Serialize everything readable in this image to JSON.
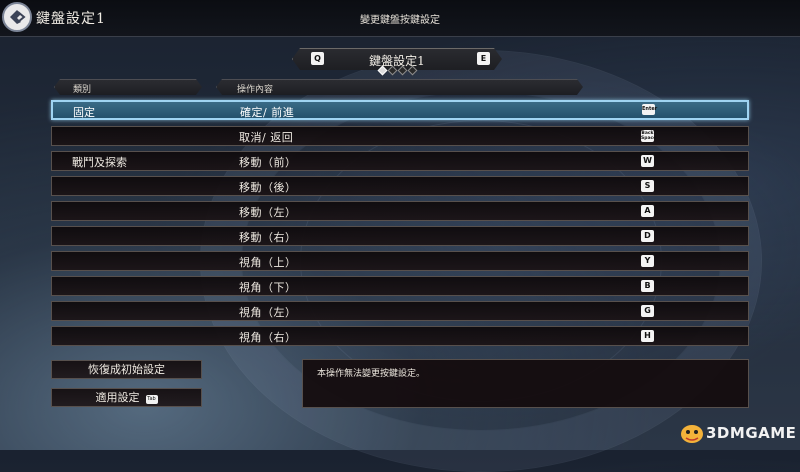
{
  "header": {
    "screen_title": "鍵盤設定1",
    "title": "變更鍵盤按鍵設定"
  },
  "preset": {
    "label": "鍵盤設定1",
    "prev_key": "Q",
    "next_key": "E",
    "page_count": 4,
    "active_page": 1
  },
  "columns": {
    "category": "類別",
    "operation": "操作內容"
  },
  "rows": [
    {
      "category": "固定",
      "operation": "確定/ 前進",
      "key": "Enter",
      "selected": true
    },
    {
      "category": "",
      "operation": "取消/ 返回",
      "key": "Back Space",
      "selected": false
    },
    {
      "category": "戰鬥及探索",
      "operation": "移動（前）",
      "key": "W",
      "selected": false
    },
    {
      "category": "",
      "operation": "移動（後）",
      "key": "S",
      "selected": false
    },
    {
      "category": "",
      "operation": "移動（左）",
      "key": "A",
      "selected": false
    },
    {
      "category": "",
      "operation": "移動（右）",
      "key": "D",
      "selected": false
    },
    {
      "category": "",
      "operation": "視角（上）",
      "key": "Y",
      "selected": false
    },
    {
      "category": "",
      "operation": "視角（下）",
      "key": "B",
      "selected": false
    },
    {
      "category": "",
      "operation": "視角（左）",
      "key": "G",
      "selected": false
    },
    {
      "category": "",
      "operation": "視角（右）",
      "key": "H",
      "selected": false
    }
  ],
  "buttons": {
    "reset": "恢復成初始設定",
    "apply": "適用設定",
    "apply_key": "Tab"
  },
  "description": "本操作無法變更按鍵設定。",
  "watermark": "3DMGAME",
  "colors": {
    "selected_row": "#2f6682",
    "selected_border": "#9fd4f2",
    "row_bg": "#140e10",
    "text": "#efeae2"
  }
}
